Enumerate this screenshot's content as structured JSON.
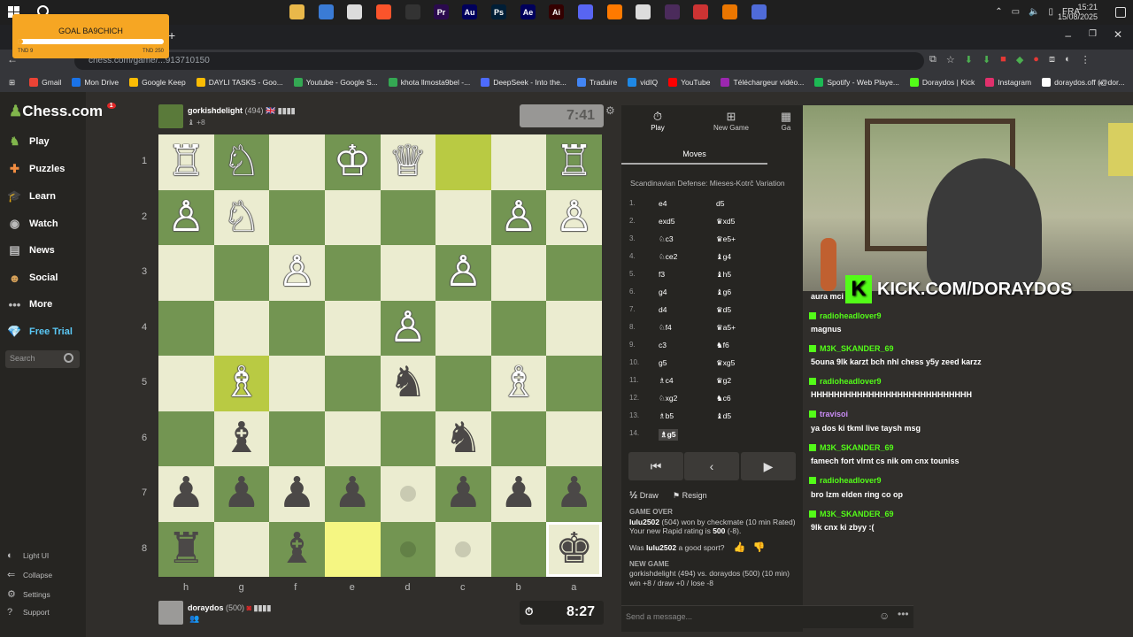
{
  "taskbar": {
    "time": "15:21",
    "date": "15/08/2025",
    "lang": "FRA",
    "apps": [
      "file-explorer",
      "store",
      "chrome",
      "brave",
      "obs",
      "premiere",
      "audition",
      "photoshop",
      "after-effects",
      "illustrator",
      "discord",
      "app",
      "chrome-2",
      "app-2",
      "app-3",
      "blender",
      "app-4"
    ]
  },
  "goal": {
    "title": "GOAL BA9CHICH",
    "left": "TND 9",
    "right": "TND 250",
    "progress": 0.036
  },
  "browser": {
    "url": "chess.com/game/...913710150",
    "bookmarks": [
      "Gmail",
      "Mon Drive",
      "Google Keep",
      "DAYLI TASKS - Goo...",
      "Youtube - Google S...",
      "khota llmosta9bel -...",
      "DeepSeek - Into the...",
      "Traduire",
      "vidIQ",
      "YouTube",
      "Téléchargeur vidéo...",
      "Spotify - Web Playe...",
      "Doraydos | Kick",
      "Instagram",
      "doraydos.off (@dor..."
    ]
  },
  "sidebar": {
    "logo": "Chess.com",
    "badge": "1",
    "items": [
      {
        "label": "Play",
        "icon": "play-icon"
      },
      {
        "label": "Puzzles",
        "icon": "puzzle-icon"
      },
      {
        "label": "Learn",
        "icon": "learn-icon"
      },
      {
        "label": "Watch",
        "icon": "watch-icon"
      },
      {
        "label": "News",
        "icon": "news-icon"
      },
      {
        "label": "Social",
        "icon": "social-icon"
      },
      {
        "label": "More",
        "icon": "more-icon"
      },
      {
        "label": "Free Trial",
        "icon": "diamond-icon"
      }
    ],
    "search_placeholder": "Search",
    "bottom": [
      "Light UI",
      "Collapse",
      "Settings",
      "Support"
    ]
  },
  "top_player": {
    "name": "gorkishdelight",
    "rating": "(494)",
    "flag": "🇬🇧",
    "material": "+8",
    "clock": "7:41"
  },
  "bottom_player": {
    "name": "doraydos",
    "rating": "(500)",
    "clock": "8:27"
  },
  "board": {
    "ranks": [
      "1",
      "2",
      "3",
      "4",
      "5",
      "6",
      "7",
      "8"
    ],
    "files": [
      "h",
      "g",
      "f",
      "e",
      "d",
      "c",
      "b",
      "a"
    ],
    "squares": [
      [
        "♖",
        "♘",
        "",
        "♔",
        "♕",
        "",
        "",
        "♖"
      ],
      [
        "♙",
        "♘",
        "",
        "",
        "",
        "",
        "♙",
        "♙"
      ],
      [
        "",
        "",
        "♙",
        "",
        "",
        "♙",
        "",
        ""
      ],
      [
        "",
        "",
        "",
        "",
        "♙",
        "",
        "",
        ""
      ],
      [
        "",
        "♗",
        "",
        "",
        "♞",
        "",
        "♗",
        ""
      ],
      [
        "",
        "♝",
        "",
        "",
        "",
        "♞",
        "",
        ""
      ],
      [
        "♟",
        "♟",
        "♟",
        "♟",
        "•",
        "♟",
        "♟",
        "♟"
      ],
      [
        "♜",
        "",
        "♝",
        "",
        "•",
        "•",
        "",
        "♚"
      ]
    ],
    "black_pieces": [
      "♜",
      "♞",
      "♝",
      "♛",
      "♚",
      "♟"
    ],
    "highlights": {
      "light": [
        [
          7,
          3
        ]
      ],
      "dark": [
        [
          0,
          5
        ],
        [
          4,
          1
        ]
      ]
    }
  },
  "panel": {
    "tabs": [
      "Play",
      "New Game",
      "Ga"
    ],
    "moves_tab": "Moves",
    "opening": "Scandinavian Defense: Mieses-Kotrč Variation",
    "moves": [
      {
        "n": "1.",
        "w": "e4",
        "b": "d5"
      },
      {
        "n": "2.",
        "w": "exd5",
        "b": "♛xd5"
      },
      {
        "n": "3.",
        "w": "♘c3",
        "b": "♛e5+"
      },
      {
        "n": "4.",
        "w": "♘ce2",
        "b": "♝g4"
      },
      {
        "n": "5.",
        "w": "f3",
        "b": "♝h5"
      },
      {
        "n": "6.",
        "w": "g4",
        "b": "♝g6"
      },
      {
        "n": "7.",
        "w": "d4",
        "b": "♛d5"
      },
      {
        "n": "8.",
        "w": "♘f4",
        "b": "♛a5+"
      },
      {
        "n": "9.",
        "w": "c3",
        "b": "♞f6"
      },
      {
        "n": "10.",
        "w": "g5",
        "b": "♛xg5"
      },
      {
        "n": "11.",
        "w": "♗c4",
        "b": "♛g2"
      },
      {
        "n": "12.",
        "w": "♘xg2",
        "b": "♞c6"
      },
      {
        "n": "13.",
        "w": "♗b5",
        "b": "♝d5"
      },
      {
        "n": "14.",
        "w": "♗g5",
        "b": ""
      }
    ],
    "draw": "Draw",
    "resign": "Resign",
    "draw_icon": "½",
    "log": {
      "game_over": "GAME OVER",
      "winner": "lulu2502",
      "result": " (504) won by checkmate (10 min Rated)",
      "rating_line": "Your new Rapid rating is ",
      "rating_value": "500",
      "rating_delta": " (-8).",
      "sport_q1": "Was ",
      "sport_name": "lulu2502",
      "sport_q2": " a good sport?",
      "new_game": "NEW GAME",
      "ng_p1": "gorkishdelight",
      "ng_mid": " (494) vs. ",
      "ng_p2": "doraydos",
      "ng_end": " (500) (10 min)",
      "ng_stakes": "win +8 / draw +0 / lose -8"
    },
    "send_placeholder": "Send a message..."
  },
  "stream": {
    "kick_url": "KICK.COM/DORAYDOS",
    "chat": [
      {
        "name": "",
        "msg": "aura mci"
      },
      {
        "name": "radioheadlover9",
        "msg": "magnus"
      },
      {
        "name": "M3K_SKANDER_69",
        "msg": "5ouna 9lk karzt bch nhl chess y5y zeed karzz"
      },
      {
        "name": "radioheadlover9",
        "msg": "HHHHHHHHHHHHHHHHHHHHHHHHHHHH"
      },
      {
        "name": "travisoi",
        "msg": "ya dos ki tkml live taysh msg"
      },
      {
        "name": "M3K_SKANDER_69",
        "msg": "famech fort vlrnt cs nik om cnx touniss"
      },
      {
        "name": "radioheadlover9",
        "msg": "bro lzm elden ring co op"
      },
      {
        "name": "M3K_SKANDER_69",
        "msg": "9lk cnx ki zbyy :("
      }
    ]
  },
  "colors": {
    "green": "#81b64c",
    "kick": "#53fc18",
    "board_light": "#ebecd0",
    "board_dark": "#739552"
  }
}
